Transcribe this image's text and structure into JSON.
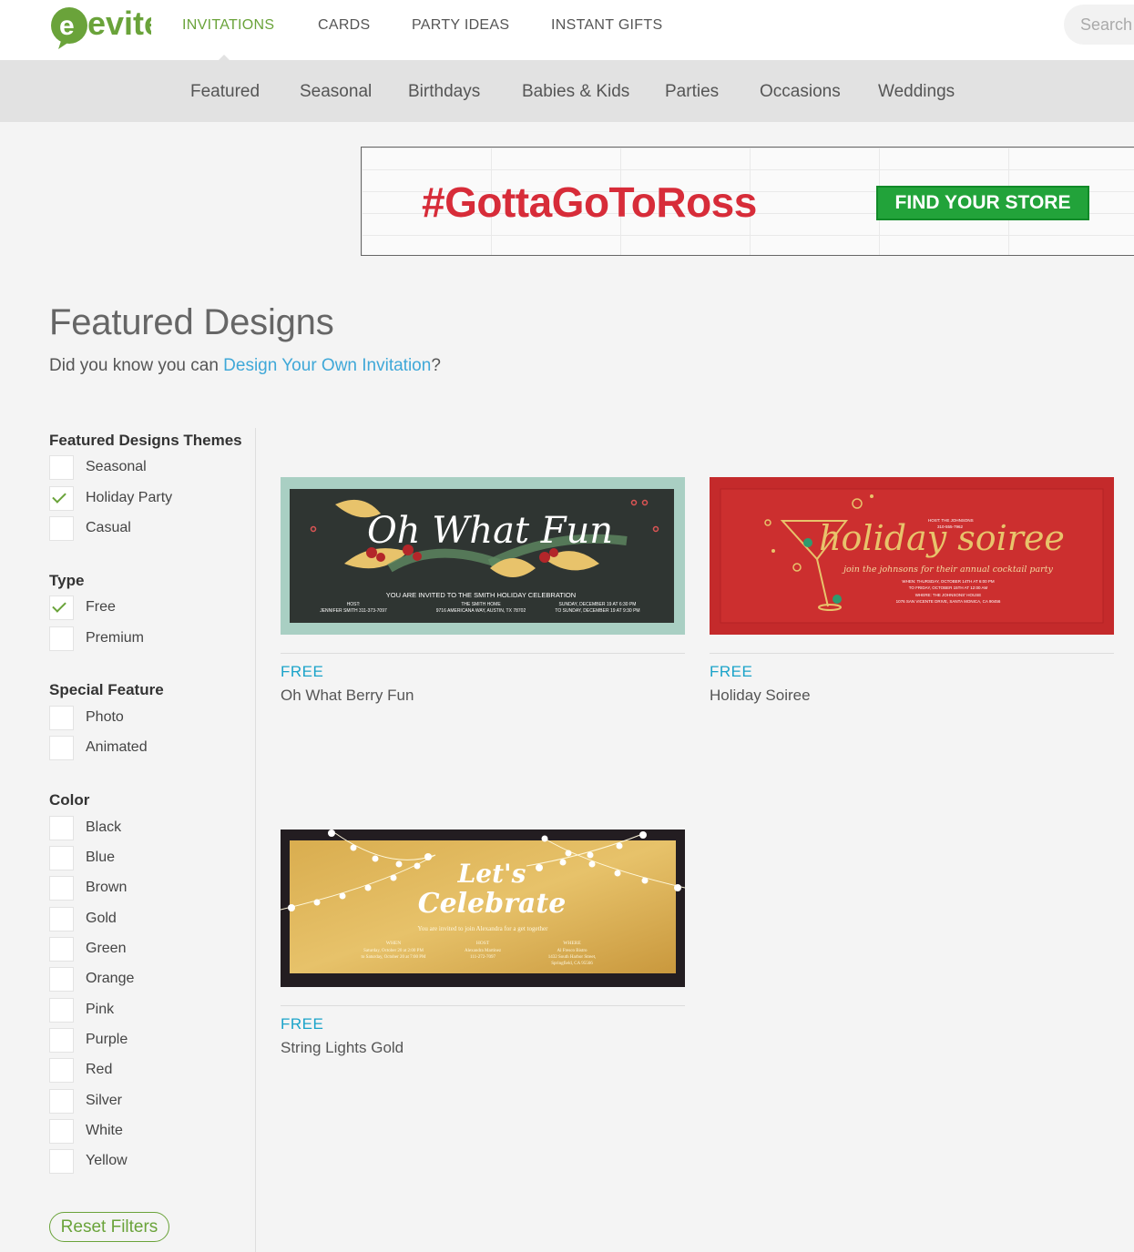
{
  "header": {
    "logo_text": "evite",
    "nav": [
      {
        "label": "INVITATIONS",
        "active": true
      },
      {
        "label": "CARDS",
        "active": false
      },
      {
        "label": "PARTY IDEAS",
        "active": false
      },
      {
        "label": "INSTANT GIFTS",
        "active": false
      }
    ],
    "search_placeholder": "Search"
  },
  "subnav": {
    "items": [
      "Featured",
      "Seasonal",
      "Birthdays",
      "Babies & Kids",
      "Parties",
      "Occasions",
      "Weddings"
    ],
    "active": "Featured"
  },
  "ad": {
    "hashtag": "#GottaGoToRoss",
    "button": "FIND YOUR STORE"
  },
  "page": {
    "title": "Featured Designs",
    "intro_prefix": "Did you know you can ",
    "intro_link": "Design Your Own Invitation",
    "intro_suffix": "?"
  },
  "filters": {
    "themes": {
      "title": "Featured Designs Themes",
      "items": [
        {
          "label": "Seasonal",
          "checked": false
        },
        {
          "label": "Holiday Party",
          "checked": true
        },
        {
          "label": "Casual",
          "checked": false
        }
      ]
    },
    "type": {
      "title": "Type",
      "items": [
        {
          "label": "Free",
          "checked": true
        },
        {
          "label": "Premium",
          "checked": false
        }
      ]
    },
    "special": {
      "title": "Special Feature",
      "items": [
        {
          "label": "Photo",
          "checked": false
        },
        {
          "label": "Animated",
          "checked": false
        }
      ]
    },
    "color": {
      "title": "Color",
      "items": [
        {
          "label": "Black",
          "checked": false
        },
        {
          "label": "Blue",
          "checked": false
        },
        {
          "label": "Brown",
          "checked": false
        },
        {
          "label": "Gold",
          "checked": false
        },
        {
          "label": "Green",
          "checked": false
        },
        {
          "label": "Orange",
          "checked": false
        },
        {
          "label": "Pink",
          "checked": false
        },
        {
          "label": "Purple",
          "checked": false
        },
        {
          "label": "Red",
          "checked": false
        },
        {
          "label": "Silver",
          "checked": false
        },
        {
          "label": "White",
          "checked": false
        },
        {
          "label": "Yellow",
          "checked": false
        }
      ]
    },
    "reset_label": "Reset Filters"
  },
  "designs": [
    {
      "price": "FREE",
      "name": "Oh What Berry Fun",
      "art": {
        "headline": "Oh What Fun",
        "line1": "YOU ARE INVITED TO THE SMITH HOLIDAY CELEBRATION",
        "host_label": "HOST:",
        "host": "JENNIFER SMITH 311-373-7097",
        "place_label": "THE SMITH HOME",
        "place": "9716 AMERICANA WAY, AUSTIN, TX 78702",
        "when1": "SUNDAY, DECEMBER 19 AT 6:30 PM",
        "when2": "TO SUNDAY, DECEMBER 19 AT 9:30 PM"
      }
    },
    {
      "price": "FREE",
      "name": "Holiday Soiree",
      "art": {
        "headline": "holiday soiree",
        "tagline": "join the johnsons for their annual cocktail party",
        "host": "HOST: THE JOHNSONS",
        "phone": "310-555-7962",
        "when1": "WHEN: THURSDAY, OCTOBER 14TH AT 6:00 PM",
        "when2": "TO FRIDAY, OCTOBER 15TH AT 12:00 AM",
        "where1": "WHERE: THE JOHNSONS' HOUSE",
        "where2": "1076 SAN VICENTE DRIVE, SANTA MONICA, CA 90456"
      }
    },
    {
      "price": "FREE",
      "name": "String Lights Gold",
      "art": {
        "headline1": "Let's",
        "headline2": "Celebrate",
        "invite": "You are invited to join Alexandra for a get together",
        "when_label": "WHEN",
        "when": "Saturday, October 20 at 2:00 PM",
        "when2": "to Saturday, October 20 at 7:00 PM",
        "host_label": "HOST",
        "host": "Alexandra Martinez",
        "host2": "111-272-7097",
        "where_label": "WHERE",
        "where": "Al Fresco Bistro",
        "where2": "1432 South Harbor Street,",
        "where3": "Springfield, CA 95566"
      }
    }
  ],
  "colors": {
    "brand_green": "#6aa33a",
    "link_blue": "#3fa8d8",
    "price_blue": "#1aa3c9",
    "ad_red": "#d72c39",
    "ad_button_green": "#22a33a"
  }
}
